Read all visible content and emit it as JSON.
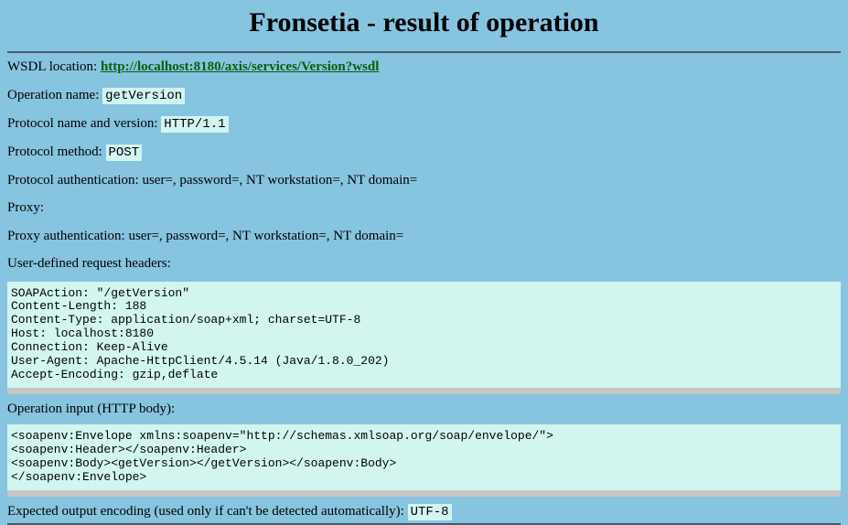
{
  "title": "Fronsetia - result of operation",
  "wsdl": {
    "label": "WSDL location: ",
    "url": "http://localhost:8180/axis/services/Version?wsdl"
  },
  "operation": {
    "label": "Operation name: ",
    "value": "getVersion"
  },
  "protocol": {
    "label": "Protocol name and version: ",
    "value": "HTTP/1.1"
  },
  "method": {
    "label": "Protocol method: ",
    "value": "POST"
  },
  "auth": {
    "label": "Protocol authentication: user=, password=, NT workstation=, NT domain="
  },
  "proxy": {
    "label": "Proxy:"
  },
  "proxy_auth": {
    "label": "Proxy authentication: user=, password=, NT workstation=, NT domain="
  },
  "headers": {
    "label": "User-defined request headers:",
    "content": "SOAPAction: \"/getVersion\"\nContent-Length: 188\nContent-Type: application/soap+xml; charset=UTF-8\nHost: localhost:8180\nConnection: Keep-Alive\nUser-Agent: Apache-HttpClient/4.5.14 (Java/1.8.0_202)\nAccept-Encoding: gzip,deflate"
  },
  "input": {
    "label": "Operation input (HTTP body):",
    "content": "<soapenv:Envelope xmlns:soapenv=\"http://schemas.xmlsoap.org/soap/envelope/\">\n<soapenv:Header></soapenv:Header>\n<soapenv:Body><getVersion></getVersion></soapenv:Body>\n</soapenv:Envelope>"
  },
  "encoding": {
    "label": "Expected output encoding (used only if can't be detected automatically): ",
    "value": "UTF-8"
  }
}
